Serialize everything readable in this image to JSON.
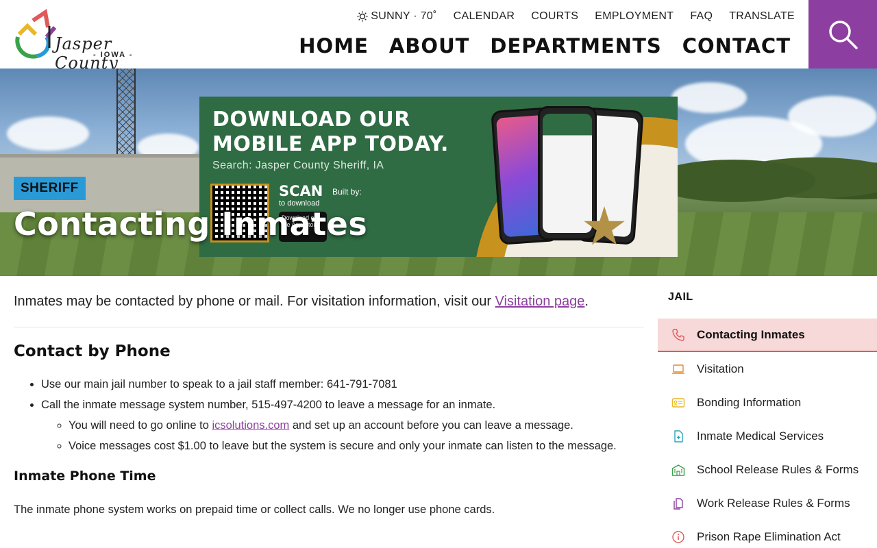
{
  "header": {
    "logo": {
      "name": "Jasper County",
      "state": "- IOWA -"
    },
    "utility": {
      "weather": "SUNNY · 70˚",
      "links": [
        "CALENDAR",
        "COURTS",
        "EMPLOYMENT",
        "FAQ",
        "TRANSLATE"
      ]
    },
    "nav": [
      "HOME",
      "ABOUT",
      "DEPARTMENTS",
      "CONTACT"
    ],
    "search_icon": "search-icon",
    "accent": "#8c3fa0"
  },
  "hero": {
    "promo": {
      "headline": "DOWNLOAD OUR MOBILE APP TODAY.",
      "search": "Search: Jasper County Sheriff, IA",
      "scan": "SCAN",
      "scan_sub": "to download",
      "built_by": "Built by:",
      "store": "Download on the App Store"
    },
    "tag": "SHERIFF",
    "title": "Contacting Inmates"
  },
  "content": {
    "intro_text": "Inmates may be contacted by phone or mail. For visitation information, visit our ",
    "intro_link": "Visitation page",
    "intro_end": ".",
    "phone_heading": "Contact by Phone",
    "bullets": {
      "b1": "Use our main jail number to speak to a jail staff member: 641-791-7081",
      "b2": "Call the inmate message system number, 515-497-4200 to leave a message for an inmate.",
      "b2a_pre": "You will need to go online to ",
      "b2a_link": "icsolutions.com",
      "b2a_post": " and set up an account before you can leave a message.",
      "b2b": "Voice messages cost $1.00 to leave but the system is secure and only your inmate can listen to the message."
    },
    "phone_time_heading": "Inmate Phone Time",
    "phone_time_text": "The inmate phone system works on prepaid time or collect calls. We no longer use phone cards."
  },
  "sidebar": {
    "title": "JAIL",
    "items": [
      {
        "label": "Contacting Inmates",
        "icon": "phone-icon",
        "color": "#e05a5a",
        "active": true
      },
      {
        "label": "Visitation",
        "icon": "laptop-icon",
        "color": "#e58a2e",
        "active": false
      },
      {
        "label": "Bonding Information",
        "icon": "id-card-icon",
        "color": "#e8b82a",
        "active": false
      },
      {
        "label": "Inmate Medical Services",
        "icon": "medical-file-icon",
        "color": "#2aa6b8",
        "active": false
      },
      {
        "label": "School Release Rules & Forms",
        "icon": "school-icon",
        "color": "#3aa24a",
        "active": false
      },
      {
        "label": "Work Release Rules & Forms",
        "icon": "documents-icon",
        "color": "#8c3fa0",
        "active": false
      },
      {
        "label": "Prison Rape Elimination Act",
        "icon": "info-icon",
        "color": "#e05a5a",
        "active": false
      }
    ]
  }
}
